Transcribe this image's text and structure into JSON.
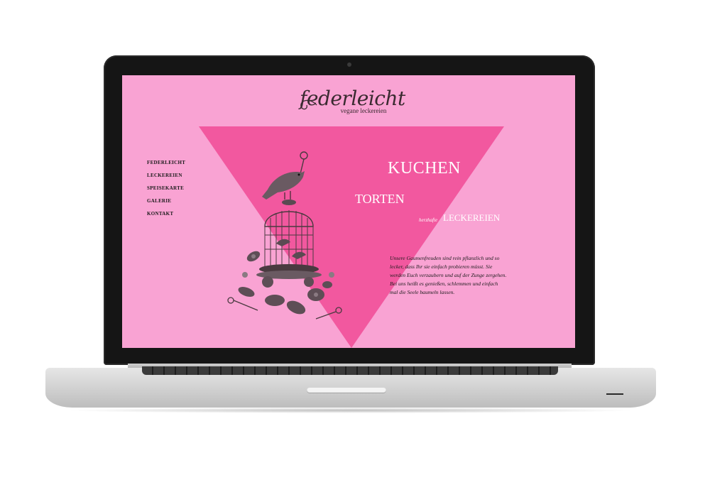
{
  "site": {
    "logo_text": "federleicht",
    "logo_subtitle": "vegane leckereien"
  },
  "nav": {
    "items": [
      {
        "label": "FEDERLEICHT"
      },
      {
        "label": "LECKEREIEN"
      },
      {
        "label": "SPEISEKARTE"
      },
      {
        "label": "GALERIE"
      },
      {
        "label": "KONTAKT"
      }
    ]
  },
  "hero": {
    "title": "KUCHEN",
    "subtitle": "TORTEN",
    "small_prefix": "herzhafte",
    "tagline": "LECKEREIEN",
    "description": "Unsere Gaumenfreuden sind rein pflanzlich und so lecker, dass Ihr sie einfach probieren müsst. Sie werden Euch verzaubern und auf der Zunge zergehen. Bei uns heißt es genießen, schlemmen und einfach mal die Seele baumeln lassen."
  },
  "colors": {
    "background": "#f9a3d3",
    "triangle": "#f2589f",
    "text_dark": "#1a1a1a",
    "text_light": "#ffffff"
  },
  "icons": {
    "illustration": "birdcage-illustration-icon"
  }
}
